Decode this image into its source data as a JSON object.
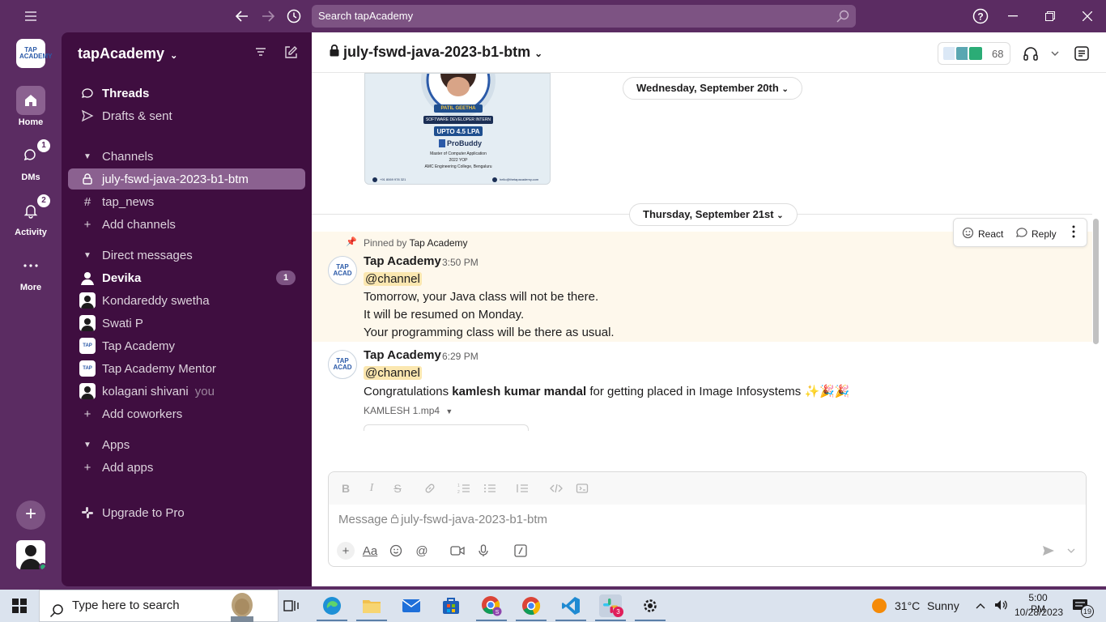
{
  "titlebar": {
    "search_placeholder": "Search tapAcademy",
    "icons": [
      "hamburger-icon",
      "back-arrow-icon",
      "forward-arrow-icon",
      "history-icon",
      "help-icon",
      "minimize-icon",
      "restore-icon",
      "close-icon"
    ]
  },
  "rail": {
    "workspace_logo": "TAP ACADEMY",
    "items": [
      {
        "label": "Home",
        "icon": "home-icon",
        "badge": ""
      },
      {
        "label": "DMs",
        "icon": "dms-icon",
        "badge": "1"
      },
      {
        "label": "Activity",
        "icon": "bell-icon",
        "badge": "2"
      },
      {
        "label": "More",
        "icon": "more-icon",
        "badge": ""
      }
    ]
  },
  "sidebar": {
    "workspace_name": "tapAcademy",
    "threads": "Threads",
    "drafts": "Drafts & sent",
    "channels_header": "Channels",
    "channels": [
      {
        "name": "july-fswd-java-2023-b1-btm",
        "private": true
      },
      {
        "name": "tap_news",
        "private": false
      }
    ],
    "add_channels": "Add channels",
    "dm_header": "Direct messages",
    "dms": [
      {
        "name": "Devika",
        "badge": "1",
        "suffix": ""
      },
      {
        "name": "Kondareddy swetha",
        "badge": "",
        "suffix": ""
      },
      {
        "name": "Swati P",
        "badge": "",
        "suffix": ""
      },
      {
        "name": "Tap Academy",
        "badge": "",
        "suffix": ""
      },
      {
        "name": "Tap Academy Mentor",
        "badge": "",
        "suffix": ""
      },
      {
        "name": "kolagani shivani",
        "badge": "",
        "suffix": "you"
      }
    ],
    "add_coworkers": "Add coworkers",
    "apps_header": "Apps",
    "add_apps": "Add apps",
    "upgrade": "Upgrade to Pro"
  },
  "channel": {
    "title": "july-fswd-java-2023-b1-btm",
    "member_count": "68"
  },
  "image_card": {
    "name_tag": "PATIL GEETHA",
    "role": "SOFTWARE DEVELOPER INTERN",
    "package": "UPTO 4.5 LPA",
    "brand": "ProBuddy",
    "degree": "Master of Computer Application",
    "yop": "2022 YOP",
    "college": "AMC Engineering College, Bengaluru",
    "phone": "+91 8069 978 321",
    "email": "hello@thetapacademy.com"
  },
  "dates": {
    "first": "Wednesday, September 20th",
    "second": "Thursday, September 21st"
  },
  "messages": [
    {
      "pinned_prefix": "Pinned by",
      "pinned_by": "Tap Academy",
      "sender": "Tap Academy",
      "time": "3:50 PM",
      "mention": "@channel",
      "lines": [
        "Tomorrow, your Java class will not be there.",
        "It will be resumed on Monday.",
        "Your programming class will be there as usual."
      ]
    },
    {
      "sender": "Tap Academy",
      "time": "6:29 PM",
      "mention": "@channel",
      "text_before": "Congratulations ",
      "bold_name": "kamlesh kumar mandal",
      "text_after": " for getting placed in Image Infosystems ✨🎉🎉",
      "file": "KAMLESH 1.mp4"
    }
  ],
  "actions": {
    "react": "React",
    "reply": "Reply"
  },
  "composer": {
    "placeholder_prefix": "Message",
    "placeholder_channel": "july-fswd-java-2023-b1-btm",
    "format_icons": [
      "bold-icon",
      "italic-icon",
      "strikethrough-icon",
      "link-icon",
      "ordered-list-icon",
      "bullet-list-icon",
      "blockquote-icon",
      "code-icon",
      "code-block-icon"
    ]
  },
  "taskbar": {
    "search_placeholder": "Type here to search",
    "weather_temp": "31°C",
    "weather_desc": "Sunny",
    "time": "5:00 PM",
    "date": "10/28/2023",
    "notification_count": "19",
    "slack_badge": "3"
  },
  "colors": {
    "aubergine": "#5b2c62",
    "sidebar": "#3f0e40",
    "selected": "#8b6190",
    "pinned_bg": "#fef8ec",
    "mention_bg": "#fbe7b0"
  }
}
